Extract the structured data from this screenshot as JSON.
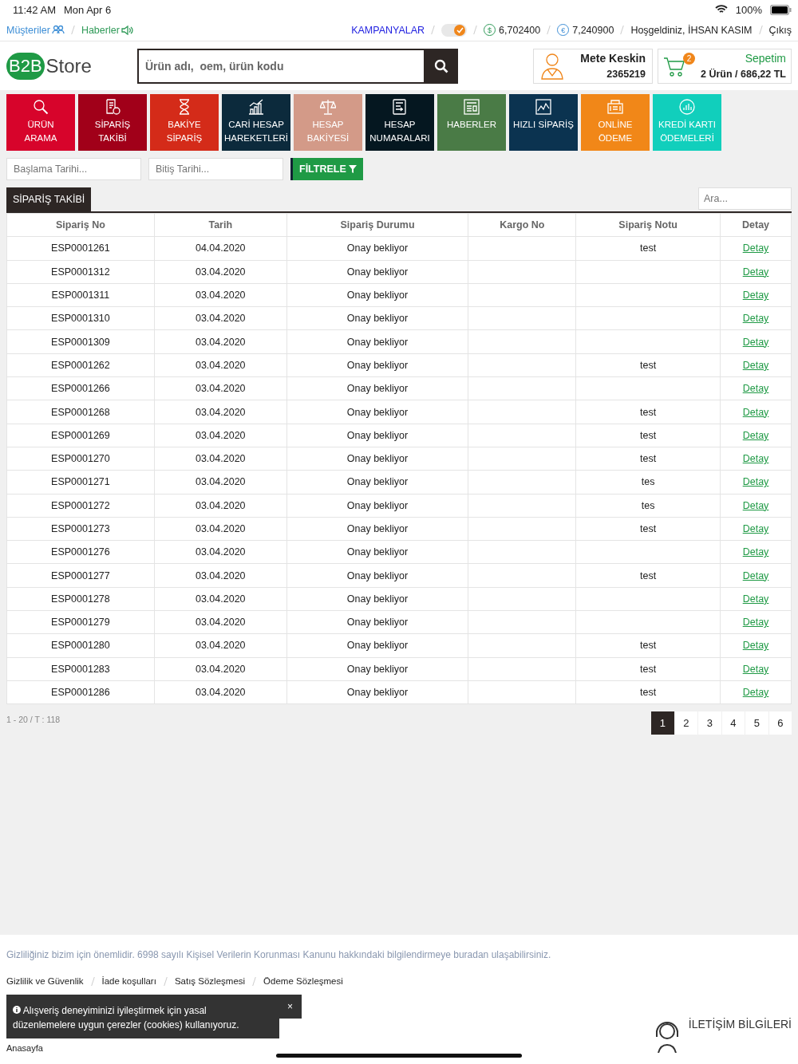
{
  "status_bar": {
    "time": "11:42 AM",
    "date": "Mon Apr 6",
    "battery": "100%"
  },
  "top_bar": {
    "links": [
      {
        "label": "Müşteriler"
      },
      {
        "label": "Haberler"
      }
    ],
    "campaigns": "KAMPANYALAR",
    "toggle_on": true,
    "balances": [
      {
        "symbol": "$",
        "value": "6,702400"
      },
      {
        "symbol": "€",
        "value": "7,240900"
      }
    ],
    "welcome": "Hoşgeldiniz, İHSAN KASIM",
    "logout": "Çıkış"
  },
  "header": {
    "logo_badge": "B2B",
    "logo_text": "Store",
    "search": {
      "placeholder": "Ürün adı,  oem, ürün kodu"
    },
    "user": {
      "name": "Mete Keskin",
      "code": "2365219"
    },
    "cart": {
      "count": "2",
      "title": "Sepetim",
      "summary": "2 Ürün / 686,22 TL"
    }
  },
  "tiles": [
    {
      "lines": [
        "ÜRÜN",
        "ARAMA"
      ],
      "color": "#d7042b"
    },
    {
      "lines": [
        "SİPARİŞ",
        "TAKİBİ"
      ],
      "color": "#a10019"
    },
    {
      "lines": [
        "BAKİYE",
        "SİPARİŞ"
      ],
      "color": "#d42b19"
    },
    {
      "lines": [
        "CARİ HESAP",
        "HAREKETLERİ"
      ],
      "color": "#0c2a3c"
    },
    {
      "lines": [
        "HESAP",
        "BAKİYESİ"
      ],
      "color": "#d39a88"
    },
    {
      "lines": [
        "HESAP",
        "NUMARALARI"
      ],
      "color": "#051720"
    },
    {
      "lines": [
        "HABERLER"
      ],
      "color": "#4a7b46"
    },
    {
      "lines": [
        "HIZLI SİPARİŞ"
      ],
      "color": "#0b3350"
    },
    {
      "lines": [
        "ONLİNE",
        "ÖDEME"
      ],
      "color": "#f18718"
    },
    {
      "lines": [
        "KREDİ KARTI",
        "ÖDEMELERİ"
      ],
      "color": "#11cfbc"
    }
  ],
  "filter": {
    "start_placeholder": "Başlama Tarihi...",
    "end_placeholder": "Bitiş Tarihi...",
    "button": "FİLTRELE"
  },
  "tab": {
    "label": "SİPARİŞ TAKİBİ"
  },
  "table_search": {
    "placeholder": "Ara..."
  },
  "table": {
    "columns": [
      "Sipariş No",
      "Tarih",
      "Sipariş Durumu",
      "Kargo No",
      "Sipariş Notu",
      "Detay"
    ],
    "rows": [
      {
        "order_no": "ESP0001261",
        "date": "04.04.2020",
        "status": "Onay bekliyor",
        "note": "test",
        "detail": "Detay"
      },
      {
        "order_no": "ESP0001312",
        "date": "03.04.2020",
        "status": "Onay bekliyor",
        "detail": "Detay"
      },
      {
        "order_no": "ESP0001311",
        "date": "03.04.2020",
        "status": "Onay bekliyor",
        "detail": "Detay"
      },
      {
        "order_no": "ESP0001310",
        "date": "03.04.2020",
        "status": "Onay bekliyor",
        "detail": "Detay"
      },
      {
        "order_no": "ESP0001309",
        "date": "03.04.2020",
        "status": "Onay bekliyor",
        "detail": "Detay"
      },
      {
        "order_no": "ESP0001262",
        "date": "03.04.2020",
        "status": "Onay bekliyor",
        "note": "test",
        "detail": "Detay"
      },
      {
        "order_no": "ESP0001266",
        "date": "03.04.2020",
        "status": "Onay bekliyor",
        "detail": "Detay"
      },
      {
        "order_no": "ESP0001268",
        "date": "03.04.2020",
        "status": "Onay bekliyor",
        "note": "test",
        "detail": "Detay"
      },
      {
        "order_no": "ESP0001269",
        "date": "03.04.2020",
        "status": "Onay bekliyor",
        "note": "test",
        "detail": "Detay"
      },
      {
        "order_no": "ESP0001270",
        "date": "03.04.2020",
        "status": "Onay bekliyor",
        "note": "test",
        "detail": "Detay"
      },
      {
        "order_no": "ESP0001271",
        "date": "03.04.2020",
        "status": "Onay bekliyor",
        "note": "tes",
        "detail": "Detay"
      },
      {
        "order_no": "ESP0001272",
        "date": "03.04.2020",
        "status": "Onay bekliyor",
        "note": "tes",
        "detail": "Detay"
      },
      {
        "order_no": "ESP0001273",
        "date": "03.04.2020",
        "status": "Onay bekliyor",
        "note": "test",
        "detail": "Detay"
      },
      {
        "order_no": "ESP0001276",
        "date": "03.04.2020",
        "status": "Onay bekliyor",
        "detail": "Detay"
      },
      {
        "order_no": "ESP0001277",
        "date": "03.04.2020",
        "status": "Onay bekliyor",
        "note": "test",
        "detail": "Detay"
      },
      {
        "order_no": "ESP0001278",
        "date": "03.04.2020",
        "status": "Onay bekliyor",
        "detail": "Detay"
      },
      {
        "order_no": "ESP0001279",
        "date": "03.04.2020",
        "status": "Onay bekliyor",
        "detail": "Detay"
      },
      {
        "order_no": "ESP0001280",
        "date": "03.04.2020",
        "status": "Onay bekliyor",
        "note": "test",
        "detail": "Detay"
      },
      {
        "order_no": "ESP0001283",
        "date": "03.04.2020",
        "status": "Onay bekliyor",
        "note": "test",
        "detail": "Detay"
      },
      {
        "order_no": "ESP0001286",
        "date": "03.04.2020",
        "status": "Onay bekliyor",
        "note": "test",
        "detail": "Detay"
      }
    ]
  },
  "pagination": {
    "summary": "1 - 20 / T : 118",
    "pages": [
      {
        "label": "1",
        "selected": true
      },
      {
        "label": "2",
        "selected": false
      },
      {
        "label": "3",
        "selected": false
      },
      {
        "label": "4",
        "selected": false
      },
      {
        "label": "5",
        "selected": false
      },
      {
        "label": "6",
        "selected": false
      }
    ]
  },
  "footer": {
    "privacy_text": "Gizliliğiniz bizim için önemlidir. 6998 sayılı Kişisel Verilerin Korunması Kanunu hakkındaki bilgilendirmeye buradan ulaşabilirsiniz.",
    "links": [
      "Gizlilik ve Güvenlik",
      "İade koşulları",
      "Satış Sözleşmesi",
      "Ödeme Sözleşmesi"
    ],
    "home_link": "Anasayfa",
    "contact_title": "İLETİŞİM BİLGİLERİ"
  },
  "cookie_banner": {
    "text": "Alışveriş deneyiminizi iyileştirmek için yasal düzenlemelere uygun çerezler (cookies) kullanıyoruz.",
    "close": "×"
  }
}
